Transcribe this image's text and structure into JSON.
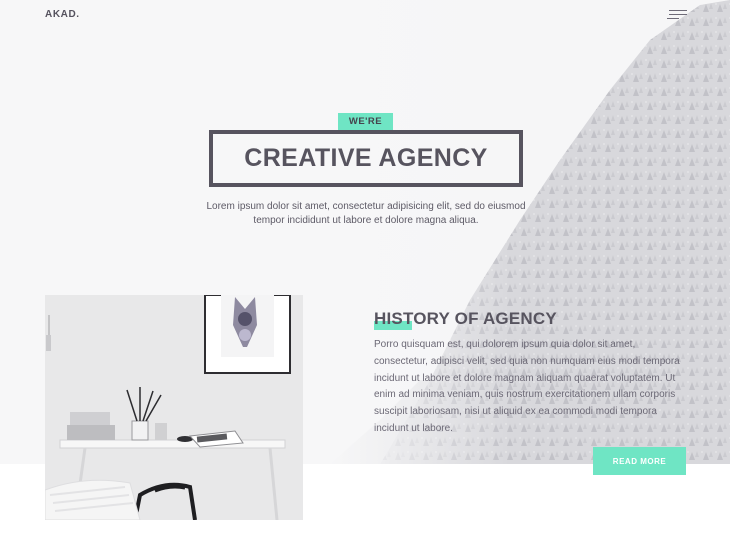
{
  "header": {
    "logo": "AKAD.",
    "menu_icon": "hamburger-menu-icon"
  },
  "hero": {
    "tagline": "WE'RE",
    "title": "CREATIVE AGENCY",
    "text_line1": "Lorem ipsum dolor sit amet, consectetur adipisicing elit, sed do eiusmod",
    "text_line2": "tempor incididunt ut labore et dolore magna aliqua."
  },
  "history": {
    "title": "HISTORY OF AGENCY",
    "text": "Porro quisquam est, qui dolorem ipsum quia dolor sit amet, consectetur, adipisci velit, sed quia non numquam eius modi tempora incidunt ut labore et dolore magnam aliquam quaerat voluptatem. Ut enim ad minima veniam, quis nostrum exercitationem ullam corporis suscipit laboriosam, nisi ut aliquid ex ea commodi modi tempora incidunt ut labore.",
    "button": "READ MORE"
  },
  "colors": {
    "accent": "#6fe5c4",
    "dark": "#57545f",
    "text": "#6b6875"
  }
}
